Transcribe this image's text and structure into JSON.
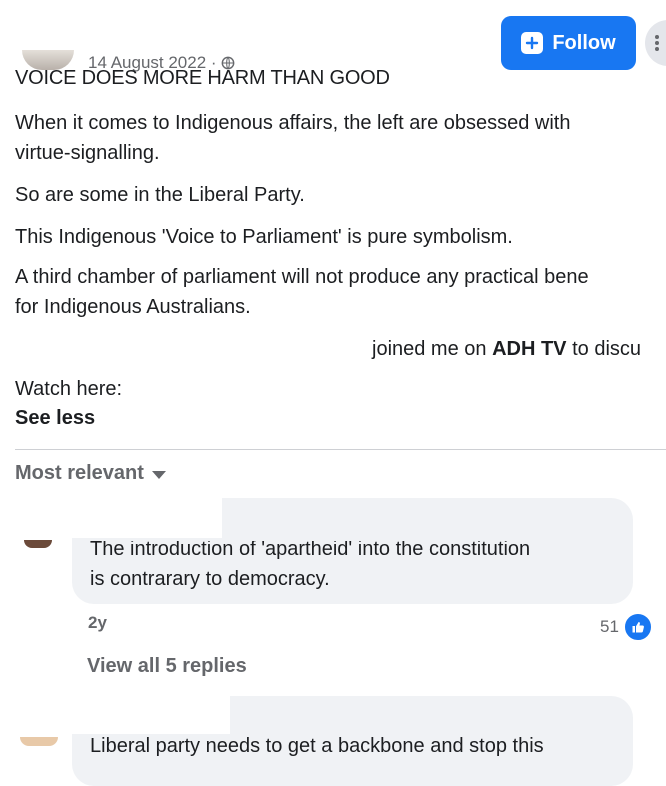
{
  "post": {
    "date": "14 August 2022 ·",
    "heading": "VOICE DOES MORE HARM THAN GOOD",
    "paragraphs": [
      "When it comes to Indigenous affairs, the left are obsessed with",
      "virtue-signalling.",
      "So are some in the Liberal Party.",
      "This Indigenous 'Voice to Parliament' is pure symbolism.",
      "A third chamber of parliament will not produce any practical bene",
      "for Indigenous Australians."
    ],
    "mention_prefix": "joined me on ",
    "mention_channel": "ADH TV",
    "mention_suffix": " to discu",
    "watch_label": "Watch here:",
    "see_less": "See less",
    "follow_label": "Follow"
  },
  "comments": {
    "sort_label": "Most relevant",
    "items": [
      {
        "line1": "The introduction of 'apartheid' into the constitution",
        "line2": "is contrarary to democracy.",
        "time": "2y",
        "reaction_count": "51",
        "view_replies": "View all 5 replies"
      },
      {
        "line1": "Liberal party needs to get a backbone and stop this"
      }
    ]
  },
  "colors": {
    "accent": "#1877f2",
    "bubble": "#f0f2f5",
    "muted_text": "#65676b"
  },
  "icons": [
    "globe-icon",
    "follow-icon",
    "more-icon",
    "caret-down-icon",
    "like-icon"
  ]
}
